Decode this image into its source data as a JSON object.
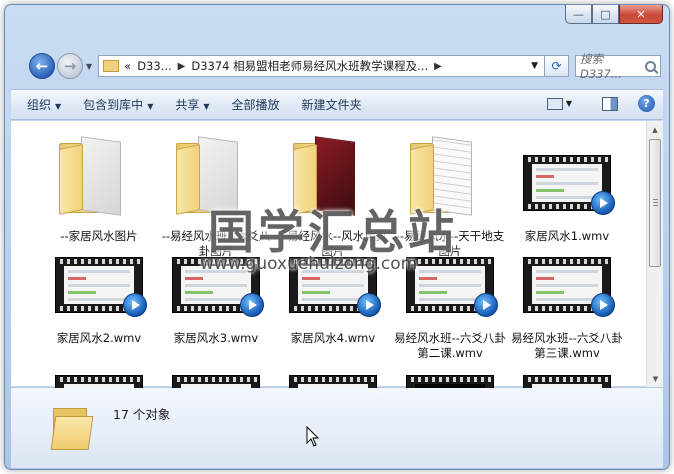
{
  "window": {
    "controls": [
      "—",
      "□",
      "✕"
    ]
  },
  "address": {
    "prefix": "«",
    "segment1": "D33...",
    "segment2": "D3374 相易盟相老师易经风水班教学课程及...",
    "search_placeholder": "搜索 D337..."
  },
  "toolbar": {
    "organize": "组织",
    "include_library": "包含到库中",
    "share": "共享",
    "play_all": "全部播放",
    "new_folder": "新建文件夹"
  },
  "items": [
    {
      "label": "--家居风水图片",
      "kind": "folder",
      "paper": "plain"
    },
    {
      "label": "--易经风水班--六爻八卦图片",
      "kind": "folder",
      "paper": "plain"
    },
    {
      "label": "--易经风水--风水用具图片",
      "kind": "folder",
      "paper": "red"
    },
    {
      "label": "--易经风水--天干地支图片",
      "kind": "folder",
      "paper": "grid"
    },
    {
      "label": "家居风水1.wmv",
      "kind": "video"
    },
    {
      "label": "家居风水2.wmv",
      "kind": "video"
    },
    {
      "label": "家居风水3.wmv",
      "kind": "video"
    },
    {
      "label": "家居风水4.wmv",
      "kind": "video"
    },
    {
      "label": "易经风水班--六爻八卦第二课.wmv",
      "kind": "video"
    },
    {
      "label": "易经风水班--六爻八卦第三课.wmv",
      "kind": "video"
    }
  ],
  "status": {
    "count_text": "17 个对象"
  },
  "watermark": {
    "main": "国学汇总站",
    "url": "www.guoxuehuizong.com"
  },
  "icons": {
    "back": "back-arrow-icon",
    "forward": "forward-arrow-icon",
    "refresh": "refresh-icon",
    "search": "search-icon",
    "help": "help-icon"
  }
}
